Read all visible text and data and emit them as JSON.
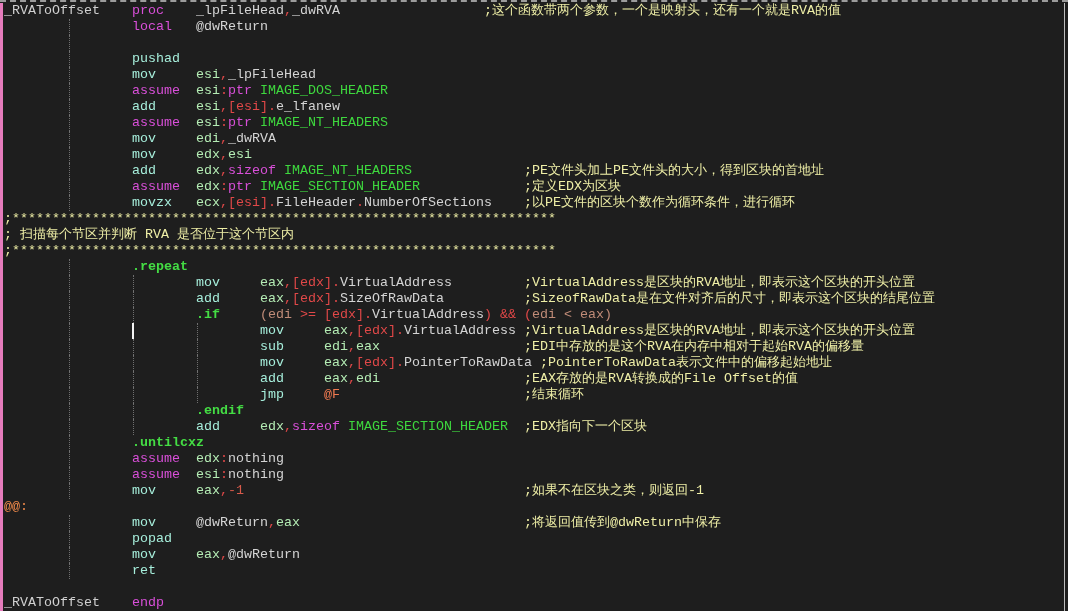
{
  "lines": [
    {
      "kind": "statement",
      "caret": false,
      "label": {
        "text": "_RVAToOffset",
        "kind": "proc_name"
      },
      "op": {
        "text": "proc",
        "kind": "directive"
      },
      "operands": [
        {
          "text": "_lpFileHead",
          "kind": "name"
        },
        {
          "text": ",",
          "kind": "punct"
        },
        {
          "text": "_dwRVA",
          "kind": "name"
        }
      ],
      "comment": ";这个函数带两个参数，一个是映射头，还有一个就是RVA的值",
      "children": [
        {
          "kind": "statement",
          "caret": false,
          "op": {
            "text": "local",
            "kind": "directive"
          },
          "operands": [
            {
              "text": "@dwReturn",
              "kind": "name"
            }
          ]
        },
        {
          "kind": "blank",
          "caret": false
        },
        {
          "kind": "statement",
          "caret": false,
          "op": {
            "text": "pushad",
            "kind": "mnemonic"
          }
        },
        {
          "kind": "statement",
          "caret": false,
          "op": {
            "text": "mov",
            "kind": "mnemonic"
          },
          "operands": [
            {
              "text": "esi",
              "kind": "register"
            },
            {
              "text": ",",
              "kind": "punct"
            },
            {
              "text": "_lpFileHead",
              "kind": "name"
            }
          ]
        },
        {
          "kind": "statement",
          "caret": false,
          "op": {
            "text": "assume",
            "kind": "directive"
          },
          "operands": [
            {
              "text": "esi",
              "kind": "register"
            },
            {
              "text": ":",
              "kind": "punct"
            },
            {
              "text": "ptr",
              "kind": "directive"
            },
            {
              "text": " IMAGE_DOS_HEADER",
              "kind": "type"
            }
          ]
        },
        {
          "kind": "statement",
          "caret": false,
          "op": {
            "text": "add",
            "kind": "mnemonic"
          },
          "operands": [
            {
              "text": "esi",
              "kind": "register"
            },
            {
              "text": ",",
              "kind": "punct"
            },
            {
              "text": "[esi]",
              "kind": "memory"
            },
            {
              "text": ".",
              "kind": "punct"
            },
            {
              "text": "e_lfanew",
              "kind": "name"
            }
          ]
        },
        {
          "kind": "statement",
          "caret": false,
          "op": {
            "text": "assume",
            "kind": "directive"
          },
          "operands": [
            {
              "text": "esi",
              "kind": "register"
            },
            {
              "text": ":",
              "kind": "punct"
            },
            {
              "text": "ptr",
              "kind": "directive"
            },
            {
              "text": " IMAGE_NT_HEADERS",
              "kind": "type"
            }
          ]
        },
        {
          "kind": "statement",
          "caret": false,
          "op": {
            "text": "mov",
            "kind": "mnemonic"
          },
          "operands": [
            {
              "text": "edi",
              "kind": "register"
            },
            {
              "text": ",",
              "kind": "punct"
            },
            {
              "text": "_dwRVA",
              "kind": "name"
            }
          ]
        },
        {
          "kind": "statement",
          "caret": false,
          "op": {
            "text": "mov",
            "kind": "mnemonic"
          },
          "operands": [
            {
              "text": "edx",
              "kind": "register"
            },
            {
              "text": ",",
              "kind": "punct"
            },
            {
              "text": "esi",
              "kind": "register"
            }
          ]
        },
        {
          "kind": "statement",
          "caret": false,
          "op": {
            "text": "add",
            "kind": "mnemonic"
          },
          "operands": [
            {
              "text": "edx",
              "kind": "register"
            },
            {
              "text": ",",
              "kind": "punct"
            },
            {
              "text": "sizeof",
              "kind": "directive"
            },
            {
              "text": " IMAGE_NT_HEADERS",
              "kind": "type"
            }
          ],
          "comment": ";PE文件头加上PE文件头的大小，得到区块的首地址"
        },
        {
          "kind": "statement",
          "caret": false,
          "op": {
            "text": "assume",
            "kind": "directive"
          },
          "operands": [
            {
              "text": "edx",
              "kind": "register"
            },
            {
              "text": ":",
              "kind": "punct"
            },
            {
              "text": "ptr",
              "kind": "directive"
            },
            {
              "text": " IMAGE_SECTION_HEADER",
              "kind": "type"
            }
          ],
          "comment": ";定义EDX为区块"
        },
        {
          "kind": "statement",
          "caret": false,
          "op": {
            "text": "movzx",
            "kind": "mnemonic"
          },
          "operands": [
            {
              "text": "ecx",
              "kind": "register"
            },
            {
              "text": ",",
              "kind": "punct"
            },
            {
              "text": "[esi]",
              "kind": "memory"
            },
            {
              "text": ".",
              "kind": "punct"
            },
            {
              "text": "FileHeader",
              "kind": "name"
            },
            {
              "text": ".",
              "kind": "punct"
            },
            {
              "text": "NumberOfSections",
              "kind": "name"
            }
          ],
          "comment": ";以PE文件的区块个数作为循环条件，进行循环"
        },
        {
          "kind": "comment",
          "caret": false,
          "comment": ";********************************************************************"
        },
        {
          "kind": "comment",
          "caret": false,
          "comment": "; 扫描每个节区并判断 RVA 是否位于这个节区内"
        },
        {
          "kind": "comment",
          "caret": false,
          "comment": ";********************************************************************"
        },
        {
          "kind": "statement",
          "caret": false,
          "op": {
            "text": ".repeat",
            "kind": "control"
          },
          "children": [
            {
              "kind": "statement",
              "caret": false,
              "op": {
                "text": "mov",
                "kind": "mnemonic"
              },
              "operands": [
                {
                  "text": "eax",
                  "kind": "register"
                },
                {
                  "text": ",",
                  "kind": "punct"
                },
                {
                  "text": "[edx]",
                  "kind": "memory"
                },
                {
                  "text": ".",
                  "kind": "punct"
                },
                {
                  "text": "VirtualAddress",
                  "kind": "name"
                }
              ],
              "comment": ";VirtualAddress是区块的RVA地址，即表示这个区块的开头位置"
            },
            {
              "kind": "statement",
              "caret": false,
              "op": {
                "text": "add",
                "kind": "mnemonic"
              },
              "operands": [
                {
                  "text": "eax",
                  "kind": "register"
                },
                {
                  "text": ",",
                  "kind": "punct"
                },
                {
                  "text": "[edx]",
                  "kind": "memory"
                },
                {
                  "text": ".",
                  "kind": "punct"
                },
                {
                  "text": "SizeOfRawData",
                  "kind": "name"
                }
              ],
              "comment": ";SizeofRawData是在文件对齐后的尺寸，即表示这个区块的结尾位置"
            },
            {
              "kind": "statement",
              "caret": false,
              "op": {
                "text": ".if",
                "kind": "control"
              },
              "operands": [
                {
                  "text": "(edi",
                  "kind": "expr"
                },
                {
                  "text": " >= ",
                  "kind": "operator"
                },
                {
                  "text": "[edx]",
                  "kind": "memory"
                },
                {
                  "text": ".",
                  "kind": "punct"
                },
                {
                  "text": "VirtualAddress",
                  "kind": "name"
                },
                {
                  "text": ") && (",
                  "kind": "operator"
                },
                {
                  "text": "edi < eax)",
                  "kind": "expr"
                }
              ],
              "children": [
                {
                  "kind": "statement",
                  "caret": true,
                  "op": {
                    "text": "mov",
                    "kind": "mnemonic"
                  },
                  "operands": [
                    {
                      "text": "eax",
                      "kind": "register"
                    },
                    {
                      "text": ",",
                      "kind": "punct"
                    },
                    {
                      "text": "[edx]",
                      "kind": "memory"
                    },
                    {
                      "text": ".",
                      "kind": "punct"
                    },
                    {
                      "text": "VirtualAddress",
                      "kind": "name"
                    }
                  ],
                  "comment": ";VirtualAddress是区块的RVA地址，即表示这个区块的开头位置"
                },
                {
                  "kind": "statement",
                  "caret": false,
                  "op": {
                    "text": "sub",
                    "kind": "mnemonic"
                  },
                  "operands": [
                    {
                      "text": "edi",
                      "kind": "register"
                    },
                    {
                      "text": ",",
                      "kind": "punct"
                    },
                    {
                      "text": "eax",
                      "kind": "register"
                    }
                  ],
                  "comment": ";EDI中存放的是这个RVA在内存中相对于起始RVA的偏移量"
                },
                {
                  "kind": "statement",
                  "caret": false,
                  "op": {
                    "text": "mov",
                    "kind": "mnemonic"
                  },
                  "operands": [
                    {
                      "text": "eax",
                      "kind": "register"
                    },
                    {
                      "text": ",",
                      "kind": "punct"
                    },
                    {
                      "text": "[edx]",
                      "kind": "memory"
                    },
                    {
                      "text": ".",
                      "kind": "punct"
                    },
                    {
                      "text": "PointerToRawData",
                      "kind": "name"
                    }
                  ],
                  "comment": ";PointerToRawData表示文件中的偏移起始地址"
                },
                {
                  "kind": "statement",
                  "caret": false,
                  "op": {
                    "text": "add",
                    "kind": "mnemonic"
                  },
                  "operands": [
                    {
                      "text": "eax",
                      "kind": "register"
                    },
                    {
                      "text": ",",
                      "kind": "punct"
                    },
                    {
                      "text": "edi",
                      "kind": "register"
                    }
                  ],
                  "comment": ";EAX存放的是RVA转换成的File Offset的值"
                },
                {
                  "kind": "statement",
                  "caret": false,
                  "op": {
                    "text": "jmp",
                    "kind": "mnemonic"
                  },
                  "operands": [
                    {
                      "text": "@F",
                      "kind": "anchor_ref"
                    }
                  ],
                  "comment": ";结束循环"
                }
              ]
            },
            {
              "kind": "statement",
              "caret": false,
              "op": {
                "text": ".endif",
                "kind": "control"
              }
            },
            {
              "kind": "statement",
              "caret": false,
              "op": {
                "text": "add",
                "kind": "mnemonic"
              },
              "operands": [
                {
                  "text": "edx",
                  "kind": "register"
                },
                {
                  "text": ",",
                  "kind": "punct"
                },
                {
                  "text": "sizeof",
                  "kind": "directive"
                },
                {
                  "text": " IMAGE_SECTION_HEADER",
                  "kind": "type"
                }
              ],
              "comment": ";EDX指向下一个区块"
            }
          ]
        },
        {
          "kind": "statement",
          "caret": false,
          "op": {
            "text": ".untilcxz",
            "kind": "control"
          }
        },
        {
          "kind": "statement",
          "caret": false,
          "op": {
            "text": "assume",
            "kind": "directive"
          },
          "operands": [
            {
              "text": "edx",
              "kind": "register"
            },
            {
              "text": ":",
              "kind": "punct"
            },
            {
              "text": "nothing",
              "kind": "name"
            }
          ]
        },
        {
          "kind": "statement",
          "caret": false,
          "op": {
            "text": "assume",
            "kind": "directive"
          },
          "operands": [
            {
              "text": "esi",
              "kind": "register"
            },
            {
              "text": ":",
              "kind": "punct"
            },
            {
              "text": "nothing",
              "kind": "name"
            }
          ]
        },
        {
          "kind": "statement",
          "caret": false,
          "op": {
            "text": "mov",
            "kind": "mnemonic"
          },
          "operands": [
            {
              "text": "eax",
              "kind": "register"
            },
            {
              "text": ",",
              "kind": "punct"
            },
            {
              "text": "-1",
              "kind": "number"
            }
          ],
          "comment": ";如果不在区块之类，则返回-1"
        },
        {
          "kind": "statement",
          "caret": false,
          "label": {
            "text": "@@:",
            "kind": "anchor"
          }
        },
        {
          "kind": "statement",
          "caret": false,
          "op": {
            "text": "mov",
            "kind": "mnemonic"
          },
          "operands": [
            {
              "text": "@dwReturn",
              "kind": "name"
            },
            {
              "text": ",",
              "kind": "punct"
            },
            {
              "text": "eax",
              "kind": "register"
            }
          ],
          "comment": ";将返回值传到@dwReturn中保存"
        },
        {
          "kind": "statement",
          "caret": false,
          "op": {
            "text": "popad",
            "kind": "mnemonic"
          }
        },
        {
          "kind": "statement",
          "caret": false,
          "op": {
            "text": "mov",
            "kind": "mnemonic"
          },
          "operands": [
            {
              "text": "eax",
              "kind": "register"
            },
            {
              "text": ",",
              "kind": "punct"
            },
            {
              "text": "@dwReturn",
              "kind": "name"
            }
          ]
        },
        {
          "kind": "statement",
          "caret": false,
          "op": {
            "text": "ret",
            "kind": "mnemonic"
          }
        }
      ]
    },
    {
      "kind": "blank",
      "caret": false
    },
    {
      "kind": "statement",
      "caret": false,
      "label": {
        "text": "_RVAToOffset",
        "kind": "proc_name"
      },
      "op": {
        "text": "endp",
        "kind": "directive"
      }
    }
  ]
}
